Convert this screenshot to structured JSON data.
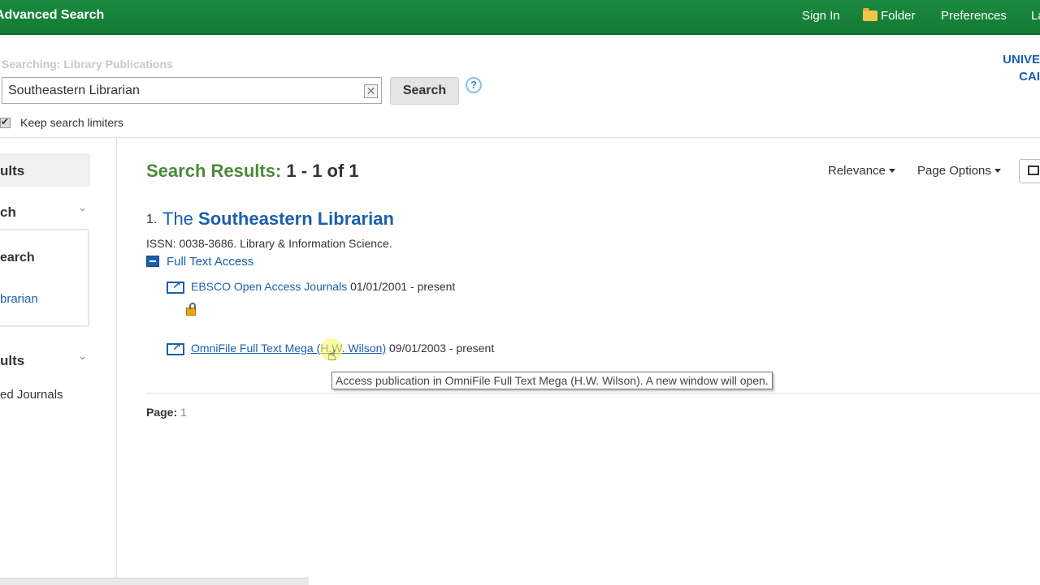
{
  "header": {
    "title": "Advanced Search",
    "nav": {
      "sign_in": "Sign In",
      "folder": "Folder",
      "preferences": "Preferences",
      "language": "La"
    }
  },
  "search": {
    "searching_label": "Searching: Library Publications",
    "query": "Southeastern Librarian",
    "button_label": "Search",
    "help_label": "?",
    "clear_label": "✕",
    "keep_limiters_label": "Keep search limiters"
  },
  "branding": {
    "line1": "UNIVE",
    "line2": "CAI"
  },
  "sidebar": {
    "heading1": "ults",
    "heading2": "ch",
    "box_heading": "earch",
    "box_link": "brarian",
    "heading3": "ults",
    "item": "ed Journals",
    "chevron": "⌄"
  },
  "results": {
    "heading_label": "Search Results:",
    "heading_range": "1 - 1 of 1",
    "sort_label": "Relevance",
    "page_options_label": "Page Options",
    "items": [
      {
        "number": "1.",
        "title_prefix": "The",
        "title_bold": "Southeastern Librarian",
        "issn_line": "ISSN: 0038-3686. Library & Information Science.",
        "full_text_label": "Full Text Access",
        "collections": [
          {
            "name": "EBSCO Open Access Journals",
            "dates": "01/01/2001 - present"
          },
          {
            "name": "OmniFile Full Text Mega (H.W. Wilson)",
            "dates": "09/01/2003 - present"
          }
        ]
      }
    ],
    "tooltip": "Access publication in OmniFile Full Text Mega (H.W. Wilson). A new window will open.",
    "page_label": "Page:",
    "page_number": "1"
  },
  "colors": {
    "header_green": "#1b8a3f",
    "link_blue": "#1b5fae",
    "results_green": "#4b8b3b"
  }
}
